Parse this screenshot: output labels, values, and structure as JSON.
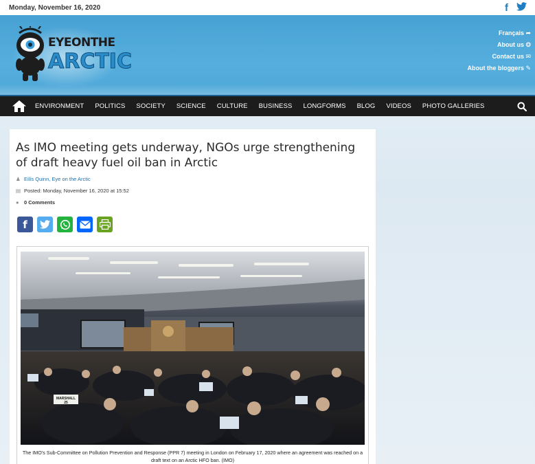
{
  "topbar": {
    "date": "Monday, November 16, 2020",
    "social_icons": [
      "facebook-icon",
      "twitter-icon"
    ]
  },
  "header": {
    "logo_line1": "EYEONTHE",
    "logo_line2": "ARCTIC",
    "links": [
      {
        "label": "Français ➦",
        "icon": "arrow-icon"
      },
      {
        "label": "About us ❂",
        "icon": "info-icon"
      },
      {
        "label": "Contact us ✉",
        "icon": "mail-icon"
      },
      {
        "label": "About the bloggers ✎",
        "icon": "pencil-icon"
      }
    ]
  },
  "nav": {
    "items": [
      "ENVIRONMENT",
      "POLITICS",
      "SOCIETY",
      "SCIENCE",
      "CULTURE",
      "BUSINESS",
      "LONGFORMS",
      "BLOG",
      "VIDEOS",
      "PHOTO GALLERIES"
    ]
  },
  "article": {
    "title": "As IMO meeting gets underway, NGOs urge strengthening of draft heavy fuel oil ban in Arctic",
    "author": "Eilís Quinn, Eye on the Arctic",
    "posted": "Posted: Monday, November 16, 2020 at 15:52",
    "comments": "0 Comments",
    "share": [
      {
        "name": "facebook",
        "glyph": "f",
        "color": "#3b5998"
      },
      {
        "name": "twitter",
        "glyph": "t",
        "color": "#55acee"
      },
      {
        "name": "whatsapp",
        "glyph": "✆",
        "color": "#25b33f"
      },
      {
        "name": "email",
        "glyph": "✉",
        "color": "#0166ff"
      },
      {
        "name": "print",
        "glyph": "⎙",
        "color": "#6aa321"
      }
    ],
    "placard": "MARSHALL\n25",
    "caption": "The IMO's Sub-Committee on Pollution Prevention and Response (PPR 7) meeting in London on February 17, 2020 where an agreement was reached on a draft text on an Arctic HFO ban. (IMO)"
  },
  "colors": {
    "header_blue": "#4ea7d8",
    "nav_bg": "#1c1c1c",
    "link_blue": "#1f6fa8"
  }
}
